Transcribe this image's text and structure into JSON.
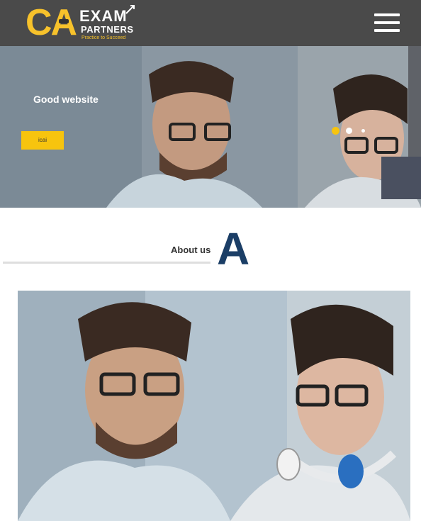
{
  "header": {
    "logo": {
      "mark": "CA",
      "line1": "EXAM",
      "line2": "PARTNERS",
      "tagline": "Practice to Succeed"
    },
    "menu_icon": "hamburger-menu-icon"
  },
  "hero": {
    "caption": "Good website",
    "button_label": "icai",
    "slides": 3,
    "active_slide": 1
  },
  "about": {
    "label": "About us",
    "letter": "A"
  },
  "colors": {
    "header_bg": "#4a4a4a",
    "accent_yellow": "#f7c40e",
    "logo_yellow": "#f7c22b",
    "heading_blue": "#1b3e66"
  }
}
